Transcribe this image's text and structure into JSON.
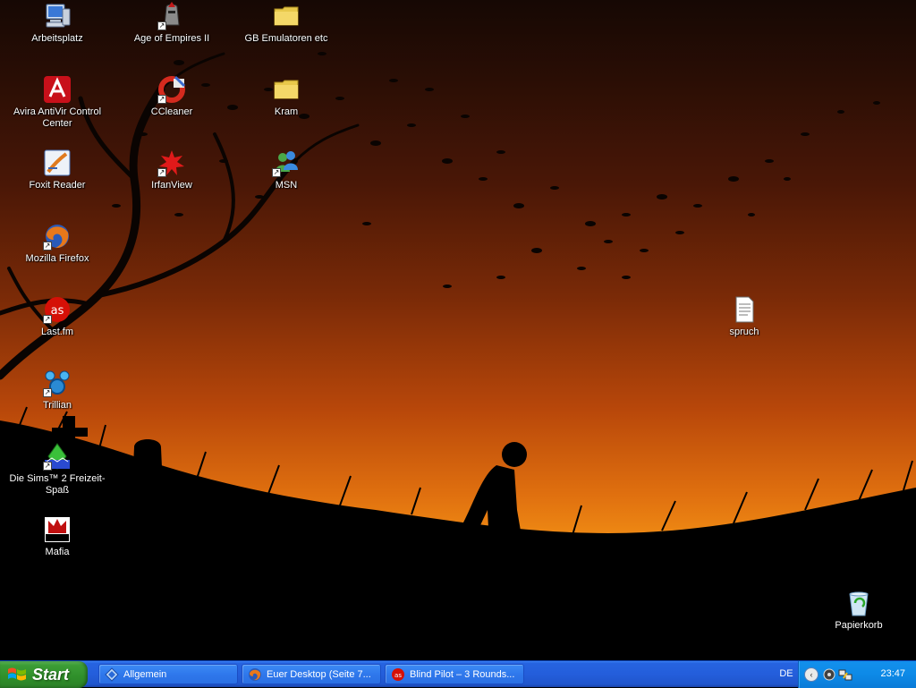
{
  "desktop": {
    "icons": [
      {
        "label": "Arbeitsplatz",
        "icon": "my-computer-icon"
      },
      {
        "label": "Age of Empires II",
        "icon": "age-of-empires-icon"
      },
      {
        "label": "GB Emulatoren etc",
        "icon": "folder-icon"
      },
      {
        "label": "Avira AntiVir Control Center",
        "icon": "avira-icon"
      },
      {
        "label": "CCleaner",
        "icon": "ccleaner-icon"
      },
      {
        "label": "Kram",
        "icon": "folder-icon"
      },
      {
        "label": "Foxit Reader",
        "icon": "foxit-reader-icon"
      },
      {
        "label": "IrfanView",
        "icon": "irfanview-icon"
      },
      {
        "label": "MSN",
        "icon": "msn-icon"
      },
      {
        "label": "Mozilla Firefox",
        "icon": "firefox-icon"
      },
      {
        "label": "Last.fm",
        "icon": "lastfm-icon"
      },
      {
        "label": "Trillian",
        "icon": "trillian-icon"
      },
      {
        "label": "Die Sims™ 2 Freizeit-Spaß",
        "icon": "sims-icon"
      },
      {
        "label": "Mafia",
        "icon": "mafia-icon"
      },
      {
        "label": "spruch",
        "icon": "text-document-icon"
      },
      {
        "label": "Papierkorb",
        "icon": "recycle-bin-icon"
      }
    ]
  },
  "taskbar": {
    "start_label": "Start",
    "tasks": [
      {
        "label": "Allgemein",
        "icon": "blue-diamond-icon"
      },
      {
        "label": "Euer Desktop (Seite 7...",
        "icon": "firefox-icon"
      },
      {
        "label": "Blind Pilot – 3 Rounds...",
        "icon": "lastfm-icon"
      }
    ],
    "language": "DE",
    "clock": "23:47"
  },
  "colors": {
    "taskbar_blue": "#245edb",
    "start_green": "#3c9d36",
    "tray_blue": "#0d8ae7",
    "sky_orange": "#f08c14"
  }
}
